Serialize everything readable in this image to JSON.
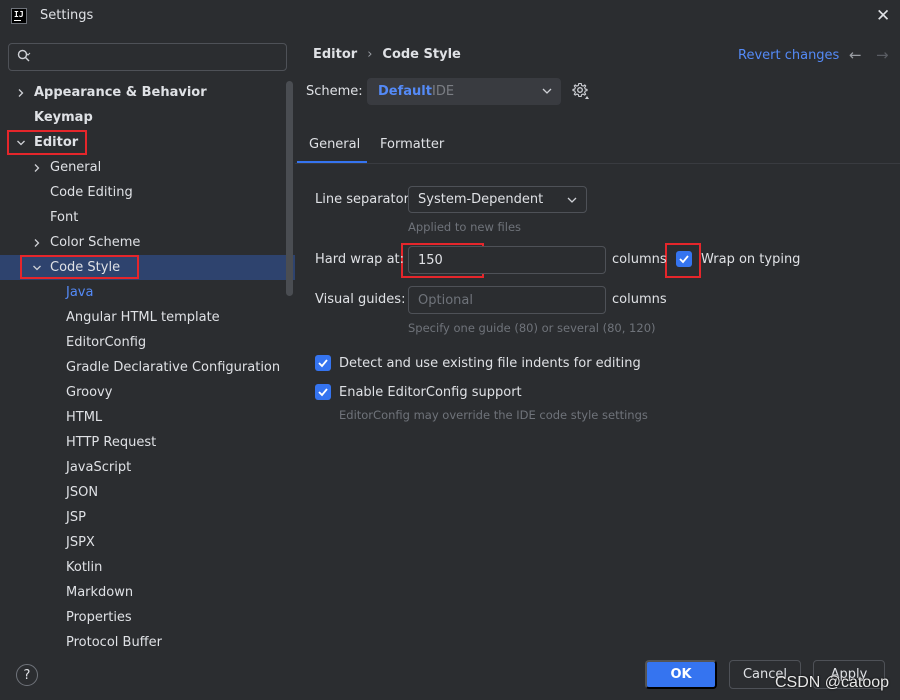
{
  "window": {
    "title": "Settings"
  },
  "search": {
    "placeholder": ""
  },
  "tree": [
    {
      "label": "Appearance & Behavior",
      "bold": true,
      "chevron": "right",
      "level": 0
    },
    {
      "label": "Keymap",
      "bold": true,
      "chevron": "",
      "level": 0
    },
    {
      "label": "Editor",
      "bold": true,
      "chevron": "down",
      "level": 0
    },
    {
      "label": "General",
      "bold": false,
      "chevron": "right",
      "level": 1
    },
    {
      "label": "Code Editing",
      "bold": false,
      "chevron": "",
      "level": 1
    },
    {
      "label": "Font",
      "bold": false,
      "chevron": "",
      "level": 1
    },
    {
      "label": "Color Scheme",
      "bold": false,
      "chevron": "right",
      "level": 1
    },
    {
      "label": "Code Style",
      "bold": false,
      "chevron": "down",
      "level": 1,
      "selected": true
    },
    {
      "label": "Java",
      "bold": false,
      "chevron": "",
      "level": 2,
      "link": true
    },
    {
      "label": "Angular HTML template",
      "bold": false,
      "chevron": "",
      "level": 2
    },
    {
      "label": "EditorConfig",
      "bold": false,
      "chevron": "",
      "level": 2
    },
    {
      "label": "Gradle Declarative Configuration",
      "bold": false,
      "chevron": "",
      "level": 2
    },
    {
      "label": "Groovy",
      "bold": false,
      "chevron": "",
      "level": 2
    },
    {
      "label": "HTML",
      "bold": false,
      "chevron": "",
      "level": 2
    },
    {
      "label": "HTTP Request",
      "bold": false,
      "chevron": "",
      "level": 2
    },
    {
      "label": "JavaScript",
      "bold": false,
      "chevron": "",
      "level": 2
    },
    {
      "label": "JSON",
      "bold": false,
      "chevron": "",
      "level": 2
    },
    {
      "label": "JSP",
      "bold": false,
      "chevron": "",
      "level": 2
    },
    {
      "label": "JSPX",
      "bold": false,
      "chevron": "",
      "level": 2
    },
    {
      "label": "Kotlin",
      "bold": false,
      "chevron": "",
      "level": 2
    },
    {
      "label": "Markdown",
      "bold": false,
      "chevron": "",
      "level": 2
    },
    {
      "label": "Properties",
      "bold": false,
      "chevron": "",
      "level": 2
    },
    {
      "label": "Protocol Buffer",
      "bold": false,
      "chevron": "",
      "level": 2
    }
  ],
  "header": {
    "breadcrumb": [
      "Editor",
      "Code Style"
    ],
    "separator": "›",
    "revert": "Revert changes"
  },
  "scheme": {
    "label": "Scheme:",
    "name": "Default",
    "sub": "IDE"
  },
  "tabs": [
    {
      "label": "General",
      "active": true
    },
    {
      "label": "Formatter",
      "active": false
    }
  ],
  "form": {
    "line_separator_label": "Line separator:",
    "line_separator_value": "System-Dependent",
    "line_separator_hint": "Applied to new files",
    "hard_wrap_label": "Hard wrap at:",
    "hard_wrap_value": "150",
    "columns_label": "columns",
    "wrap_on_typing_label": "Wrap on typing",
    "visual_guides_label": "Visual guides:",
    "visual_guides_placeholder": "Optional",
    "visual_guides_hint": "Specify one guide (80) or several (80, 120)",
    "detect_indents_label": "Detect and use existing file indents for editing",
    "editorconfig_label": "Enable EditorConfig support",
    "editorconfig_hint": "EditorConfig may override the IDE code style settings"
  },
  "footer": {
    "help": "?",
    "ok": "OK",
    "cancel": "Cancel",
    "apply": "Apply"
  },
  "watermark": "CSDN @catoop",
  "colors": {
    "accent": "#3574f0",
    "link": "#548af7",
    "selection": "#2e436e",
    "highlight": "#e5262b"
  }
}
